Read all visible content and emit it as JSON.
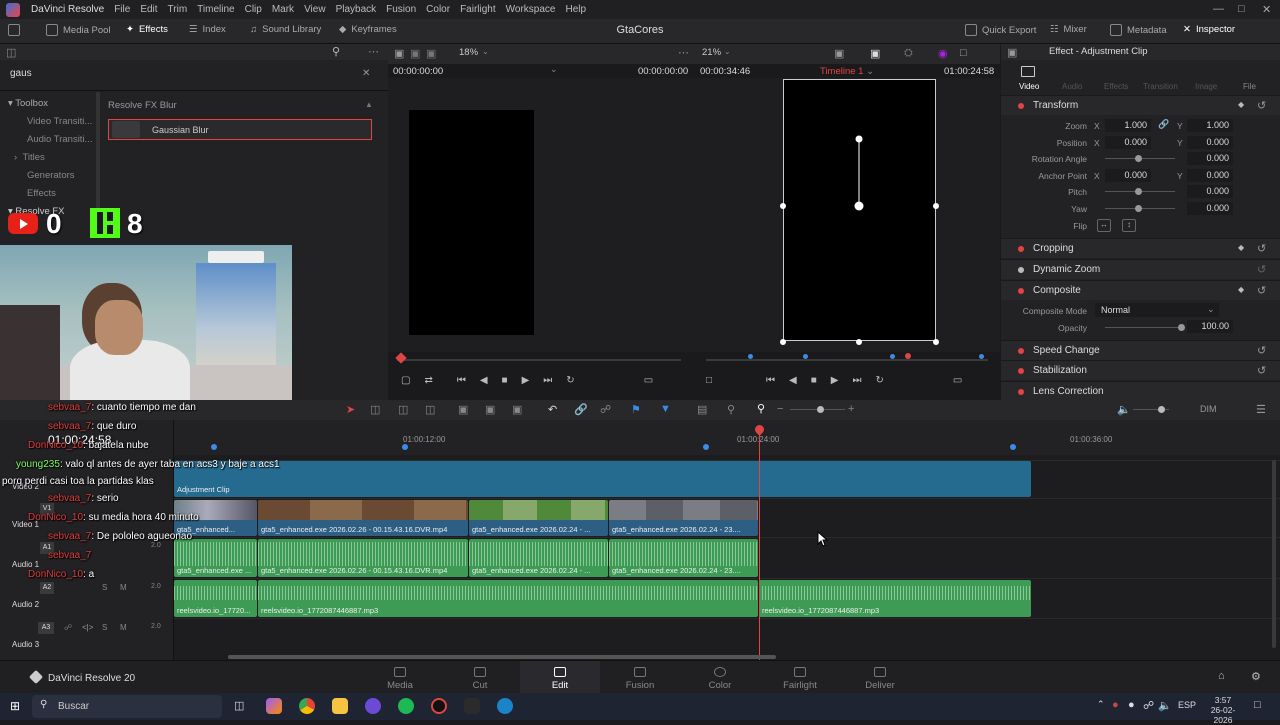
{
  "menubar": {
    "app_name": "DaVinci Resolve",
    "items": [
      "File",
      "Edit",
      "Trim",
      "Timeline",
      "Clip",
      "Mark",
      "View",
      "Playback",
      "Fusion",
      "Color",
      "Fairlight",
      "Workspace",
      "Help"
    ]
  },
  "toolbar": {
    "left": [
      "Media Pool",
      "Effects",
      "Index",
      "Sound Library",
      "Keyframes"
    ],
    "project_title": "GtaCores",
    "right": [
      "Quick Export",
      "Mixer",
      "Metadata",
      "Inspector"
    ]
  },
  "effects_panel": {
    "search_value": "gaus",
    "tree": [
      "Toolbox",
      "Video Transiti...",
      "Audio Transiti...",
      "Titles",
      "Generators",
      "Effects",
      "Resolve FX"
    ],
    "group_title": "Resolve FX Blur",
    "result": "Gaussian Blur"
  },
  "overlay": {
    "youtube_count": "0",
    "kick_count": "8",
    "timecode_overlay": "01:00:24:58"
  },
  "viewer_left": {
    "zoom": "18%",
    "timecode_left": "00:00:00:00",
    "timecode_right": "00:00:00:00"
  },
  "viewer_right": {
    "zoom": "21%",
    "duration": "00:00:34:46",
    "timeline_name": "Timeline 1",
    "timecode": "01:00:24:58"
  },
  "inspector": {
    "title": "Effect - Adjustment Clip",
    "tabs": [
      "Video",
      "Audio",
      "Effects",
      "Transition",
      "Image",
      "File"
    ],
    "transform": {
      "label": "Transform",
      "zoom_label": "Zoom",
      "zoom_x": "1.000",
      "zoom_y": "1.000",
      "position_label": "Position",
      "pos_x": "0.000",
      "pos_y": "0.000",
      "rotation_label": "Rotation Angle",
      "rotation": "0.000",
      "anchor_label": "Anchor Point",
      "anchor_x": "0.000",
      "anchor_y": "0.000",
      "pitch_label": "Pitch",
      "pitch": "0.000",
      "yaw_label": "Yaw",
      "yaw": "0.000",
      "flip_label": "Flip"
    },
    "sections": [
      "Cropping",
      "Dynamic Zoom",
      "Composite",
      "Speed Change",
      "Stabilization",
      "Lens Correction"
    ],
    "composite_mode_label": "Composite Mode",
    "composite_mode": "Normal",
    "opacity_label": "Opacity",
    "opacity": "100.00"
  },
  "timeline": {
    "ruler": [
      "01:00:12:00",
      "01:00:24:00",
      "01:00:36:00"
    ],
    "tracks": [
      "Video 2",
      "Video 1",
      "Audio 1",
      "Audio 2",
      "Audio 3"
    ],
    "track_ids": [
      "V1",
      "A1",
      "A2",
      "A3"
    ],
    "adjustment_clip": "Adjustment Clip",
    "video_clips": [
      "gta5_enhanced...",
      "gta5_enhanced.exe 2026.02.26 - 00.15.43.16.DVR.mp4",
      "gta5_enhanced.exe 2026.02.24 - ...",
      "gta5_enhanced.exe 2026.02.24 - 23...."
    ],
    "audio1_clips": [
      "gta5_enhanced.exe ...",
      "gta5_enhanced.exe 2026.02.26 - 00.15.43.16.DVR.mp4",
      "gta5_enhanced.exe 2026.02.24 - ...",
      "gta5_enhanced.exe 2026.02.24 - 23...."
    ],
    "audio2_clips": [
      "reelsvideo.io_17720...",
      "reelsvideo.io_1772087446887.mp3",
      "reelsvideo.io_1772087446887.mp3"
    ],
    "volume_label": "DIM",
    "gain_value": "2.0"
  },
  "chat": [
    {
      "user": "sebvaa_7",
      "msg": ": cuanto tiempo me dan"
    },
    {
      "user": "sebvaa_7",
      "msg": ": que duro"
    },
    {
      "user": "DonNico_10",
      "msg": ": bajatela nube"
    },
    {
      "user": "young235",
      "msg": ": valo ql antes de ayer taba en acs3 y baje a acs1"
    },
    {
      "user": "",
      "msg": "porq perdi casi toa la partidas klas"
    },
    {
      "user": "sebvaa_7",
      "msg": ": serio"
    },
    {
      "user": "DonNico_10",
      "msg": ": su media hora 40 minuto"
    },
    {
      "user": "sebvaa_7",
      "msg": ": De pololeo agueonao"
    },
    {
      "user": "sebvaa_7",
      "msg": ""
    },
    {
      "user": "DonNico_10",
      "msg": ": a"
    }
  ],
  "pages": [
    "Media",
    "Cut",
    "Edit",
    "Fusion",
    "Color",
    "Fairlight",
    "Deliver"
  ],
  "active_page": "Edit",
  "brand": "DaVinci Resolve 20",
  "taskbar": {
    "search": "Buscar",
    "lang": "ESP",
    "time": "3:57",
    "date": "26-02-2026"
  },
  "colors": {
    "accent_red": "#e04545",
    "video_clip": "#2c5f83",
    "audio_clip": "#3e9b55"
  }
}
